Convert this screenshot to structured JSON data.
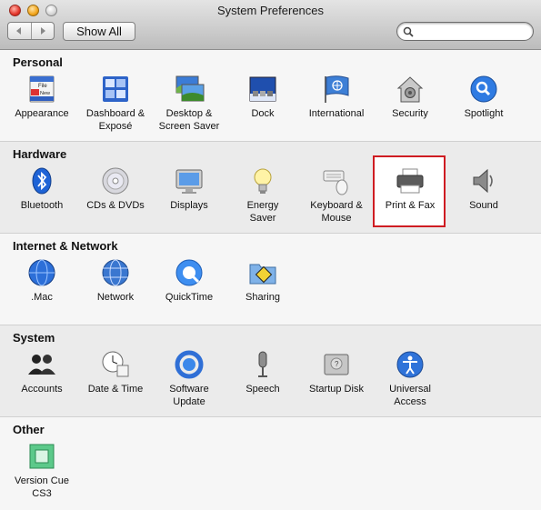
{
  "window": {
    "title": "System Preferences"
  },
  "toolbar": {
    "back_icon": "back-arrow-icon",
    "forward_icon": "forward-arrow-icon",
    "show_all_label": "Show All",
    "search_placeholder": ""
  },
  "sections": {
    "personal": {
      "title": "Personal",
      "items": [
        {
          "label": "Appearance",
          "icon": "appearance-icon"
        },
        {
          "label": "Dashboard &\nExposé",
          "icon": "dashboard-expose-icon"
        },
        {
          "label": "Desktop &\nScreen Saver",
          "icon": "desktop-screensaver-icon"
        },
        {
          "label": "Dock",
          "icon": "dock-icon"
        },
        {
          "label": "International",
          "icon": "international-flag-icon"
        },
        {
          "label": "Security",
          "icon": "security-house-icon"
        },
        {
          "label": "Spotlight",
          "icon": "spotlight-icon"
        }
      ]
    },
    "hardware": {
      "title": "Hardware",
      "items": [
        {
          "label": "Bluetooth",
          "icon": "bluetooth-icon"
        },
        {
          "label": "CDs & DVDs",
          "icon": "cd-dvd-icon"
        },
        {
          "label": "Displays",
          "icon": "display-icon"
        },
        {
          "label": "Energy\nSaver",
          "icon": "lightbulb-icon"
        },
        {
          "label": "Keyboard &\nMouse",
          "icon": "keyboard-mouse-icon"
        },
        {
          "label": "Print & Fax",
          "icon": "printer-icon"
        },
        {
          "label": "Sound",
          "icon": "speaker-icon"
        }
      ]
    },
    "internet": {
      "title": "Internet & Network",
      "items": [
        {
          "label": ".Mac",
          "icon": "dotmac-globe-icon"
        },
        {
          "label": "Network",
          "icon": "network-globe-icon"
        },
        {
          "label": "QuickTime",
          "icon": "quicktime-icon"
        },
        {
          "label": "Sharing",
          "icon": "sharing-folder-icon"
        }
      ]
    },
    "system": {
      "title": "System",
      "items": [
        {
          "label": "Accounts",
          "icon": "accounts-people-icon"
        },
        {
          "label": "Date & Time",
          "icon": "clock-calendar-icon"
        },
        {
          "label": "Software\nUpdate",
          "icon": "software-update-icon"
        },
        {
          "label": "Speech",
          "icon": "microphone-icon"
        },
        {
          "label": "Startup Disk",
          "icon": "hard-disk-icon"
        },
        {
          "label": "Universal\nAccess",
          "icon": "universal-access-icon"
        }
      ]
    },
    "other": {
      "title": "Other",
      "items": [
        {
          "label": "Version Cue\nCS3",
          "icon": "version-cue-icon"
        }
      ]
    }
  },
  "highlighted_item": "Print & Fax",
  "colors": {
    "highlight_border": "#cf1c22",
    "window_bg": "#ececec"
  }
}
